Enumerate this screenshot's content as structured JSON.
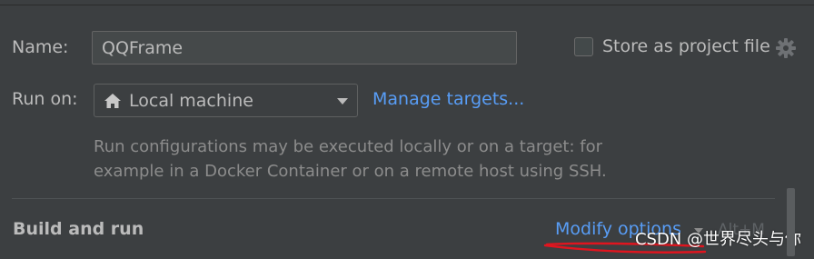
{
  "form": {
    "name_label": "Name:",
    "name_value": "QQFrame",
    "store_label": "Store as project file",
    "run_on_label": "Run on:",
    "run_on_value": "Local machine",
    "manage_targets": "Manage targets...",
    "hint_line1": "Run configurations may be executed locally or on a target: for",
    "hint_line2": "example in a Docker Container or on a remote host using SSH."
  },
  "section": {
    "title": "Build and run",
    "modify_options": "Modify options",
    "shortcut": "Alt+M"
  },
  "watermark": "CSDN @世界尽头与你",
  "icons": {
    "gear": "gear-icon",
    "home": "home-icon",
    "caret": "chevron-down-icon"
  },
  "colors": {
    "background": "#3c3f41",
    "link": "#589df6",
    "annotation": "#e0151f"
  }
}
